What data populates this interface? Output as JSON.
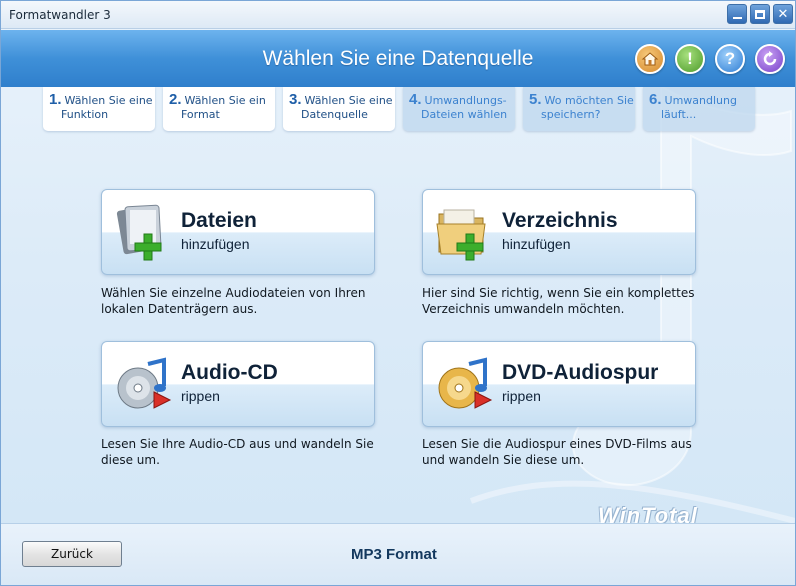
{
  "window": {
    "title": "Formatwandler 3"
  },
  "header": {
    "title": "Wählen Sie eine Datenquelle"
  },
  "header_icons": [
    "home-icon",
    "exclamation-icon",
    "help-icon",
    "refresh-icon"
  ],
  "steps": [
    {
      "num": "1.",
      "line1": "Wählen Sie eine",
      "line2": "Funktion",
      "state": "done"
    },
    {
      "num": "2.",
      "line1": "Wählen Sie ein",
      "line2": "Format",
      "state": "done"
    },
    {
      "num": "3.",
      "line1": "Wählen Sie eine",
      "line2": "Datenquelle",
      "state": "current"
    },
    {
      "num": "4.",
      "line1": "Umwandlungs-",
      "line2": "Dateien wählen",
      "state": "future"
    },
    {
      "num": "5.",
      "line1": "Wo möchten Sie",
      "line2": "speichern?",
      "state": "future"
    },
    {
      "num": "6.",
      "line1": "Umwandlung",
      "line2": "läuft...",
      "state": "future"
    }
  ],
  "options": {
    "files": {
      "title": "Dateien",
      "subtitle": "hinzufügen",
      "desc1": "Wählen Sie einzelne Audiodateien von Ihren",
      "desc2": "lokalen Datenträgern aus."
    },
    "folder": {
      "title": "Verzeichnis",
      "subtitle": "hinzufügen",
      "desc1": "Hier sind Sie richtig, wenn Sie ein komplettes",
      "desc2": "Verzeichnis umwandeln möchten."
    },
    "audiocd": {
      "title": "Audio-CD",
      "subtitle": "rippen",
      "desc1": "Lesen Sie Ihre Audio-CD aus und wandeln Sie",
      "desc2": "diese um."
    },
    "dvd": {
      "title": "DVD-Audiospur",
      "subtitle": "rippen",
      "desc1": "Lesen Sie die Audiospur eines DVD-Films aus",
      "desc2": "und wandeln Sie diese um."
    }
  },
  "footer": {
    "back_label": "Zurück",
    "format_label": "MP3 Format",
    "brand": "WinTotal"
  },
  "colors": {
    "header_blue": "#3f90d8",
    "step_text": "#1f5fa8",
    "future_step": "#3c82cf",
    "plus_green": "#3cae2c"
  }
}
